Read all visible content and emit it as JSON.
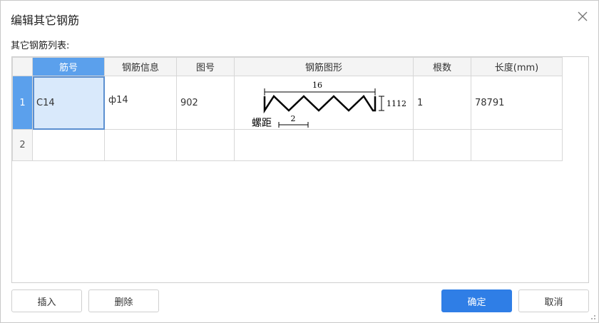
{
  "dialog": {
    "title": "编辑其它钢筋",
    "list_label": "其它钢筋列表:"
  },
  "table": {
    "headers": [
      "筋号",
      "钢筋信息",
      "图号",
      "钢筋图形",
      "根数",
      "长度(mm)"
    ],
    "rows": [
      {
        "num": "1",
        "bar_no": "C14",
        "info": "ф14",
        "figure_no": "902",
        "shape": {
          "top_length": "16",
          "height": "1112",
          "pitch_label": "螺距",
          "pitch": "2"
        },
        "count": "1",
        "length": "78791"
      },
      {
        "num": "2",
        "bar_no": "",
        "info": "",
        "figure_no": "",
        "count": "",
        "length": ""
      }
    ]
  },
  "buttons": {
    "insert": "插入",
    "delete": "删除",
    "ok": "确定",
    "cancel": "取消"
  },
  "colors": {
    "accent": "#2f7ee6",
    "header_active": "#5ba0ec",
    "selected_cell": "#d9e9fb"
  }
}
